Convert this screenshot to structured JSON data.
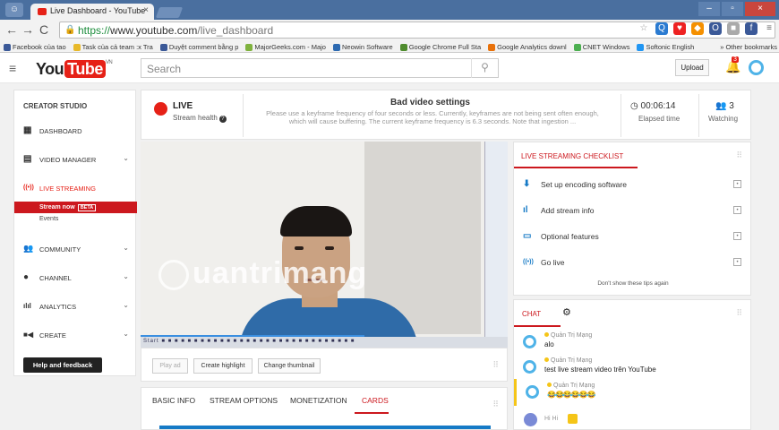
{
  "browser": {
    "tab_title": "Live Dashboard - YouTube",
    "tab_close": "×",
    "url_https": "https://",
    "url_domain": "www.youtube.com",
    "url_path": "/live_dashboard",
    "window_buttons": [
      "–",
      "▫",
      "×"
    ],
    "bookmarks": [
      {
        "label": "Facebook của tao",
        "color": "#3b5998"
      },
      {
        "label": "Task của cả team :x Tra",
        "color": "#e8b92a"
      },
      {
        "label": "Duyệt comment bằng p",
        "color": "#3b5998"
      },
      {
        "label": "MajorGeeks.com - Majo",
        "color": "#7fb23e"
      },
      {
        "label": "Neowin Software",
        "color": "#2d6ab1"
      },
      {
        "label": "Google Chrome Full Sta",
        "color": "#4f8c2e"
      },
      {
        "label": "Google Analytics downl",
        "color": "#e8710a"
      },
      {
        "label": "CNET Windows",
        "color": "#4caf50"
      },
      {
        "label": "Softonic English",
        "color": "#2196f3"
      }
    ],
    "other_bookmarks": "» Other bookmarks"
  },
  "youtube": {
    "logo_you": "You",
    "logo_tube": "Tube",
    "logo_region": "VN",
    "search_placeholder": "Search",
    "upload_label": "Upload",
    "notification_count": "3"
  },
  "sidebar": {
    "title": "CREATOR STUDIO",
    "items": [
      {
        "label": "DASHBOARD",
        "icon": "▦"
      },
      {
        "label": "VIDEO MANAGER",
        "icon": "▤"
      },
      {
        "label": "LIVE STREAMING",
        "icon": "((•))"
      },
      {
        "label": "COMMUNITY",
        "icon": "👥"
      },
      {
        "label": "CHANNEL",
        "icon": "●"
      },
      {
        "label": "ANALYTICS",
        "icon": "ılıl"
      },
      {
        "label": "CREATE",
        "icon": "■◀"
      }
    ],
    "sub_items": [
      "Stream now",
      "Events"
    ],
    "beta_badge": "BETA",
    "help_button": "Help and feedback"
  },
  "status": {
    "live_label": "LIVE",
    "health_label": "Stream health",
    "warning_title": "Bad video settings",
    "warning_desc": "Please use a keyframe frequency of four seconds or less. Currently, keyframes are not being sent often enough, which will cause buffering. The current keyframe frequency is 6.3 seconds. Note that ingestion ...",
    "elapsed": "00:06:14",
    "elapsed_label": "Elapsed time",
    "watching": "3",
    "watching_label": "Watching"
  },
  "video": {
    "watermark": "uantrimang",
    "taskbar_text": "Start ■ ■ ■ ■ ■ ■ ■ ■ ■ ■ ■ ■ ■ ■ ■ ■ ■ ■ ■ ■ ■ ■ ■ ■ ■ ■ ■ ■ ■ ■",
    "buttons": [
      "Play ad",
      "Create highlight",
      "Change thumbnail"
    ]
  },
  "tabs": [
    "BASIC INFO",
    "STREAM OPTIONS",
    "MONETIZATION",
    "CARDS"
  ],
  "checklist": {
    "title": "LIVE STREAMING CHECKLIST",
    "items": [
      {
        "label": "Set up encoding software",
        "icon": "⬇"
      },
      {
        "label": "Add stream info",
        "icon": "ıl"
      },
      {
        "label": "Optional features",
        "icon": "▭"
      },
      {
        "label": "Go live",
        "icon": "((•))"
      }
    ],
    "dont_show": "Don't show these tips again"
  },
  "chat": {
    "title": "CHAT",
    "messages": [
      {
        "name": "Quản Trị Mạng",
        "text": "alo"
      },
      {
        "name": "Quản Trị Mạng",
        "text": "test live stream video trên YouTube"
      },
      {
        "name": "Quản Trị Mạng",
        "text": "😂😂😂😂😂😂"
      }
    ],
    "input_name": "Hi Hi"
  }
}
